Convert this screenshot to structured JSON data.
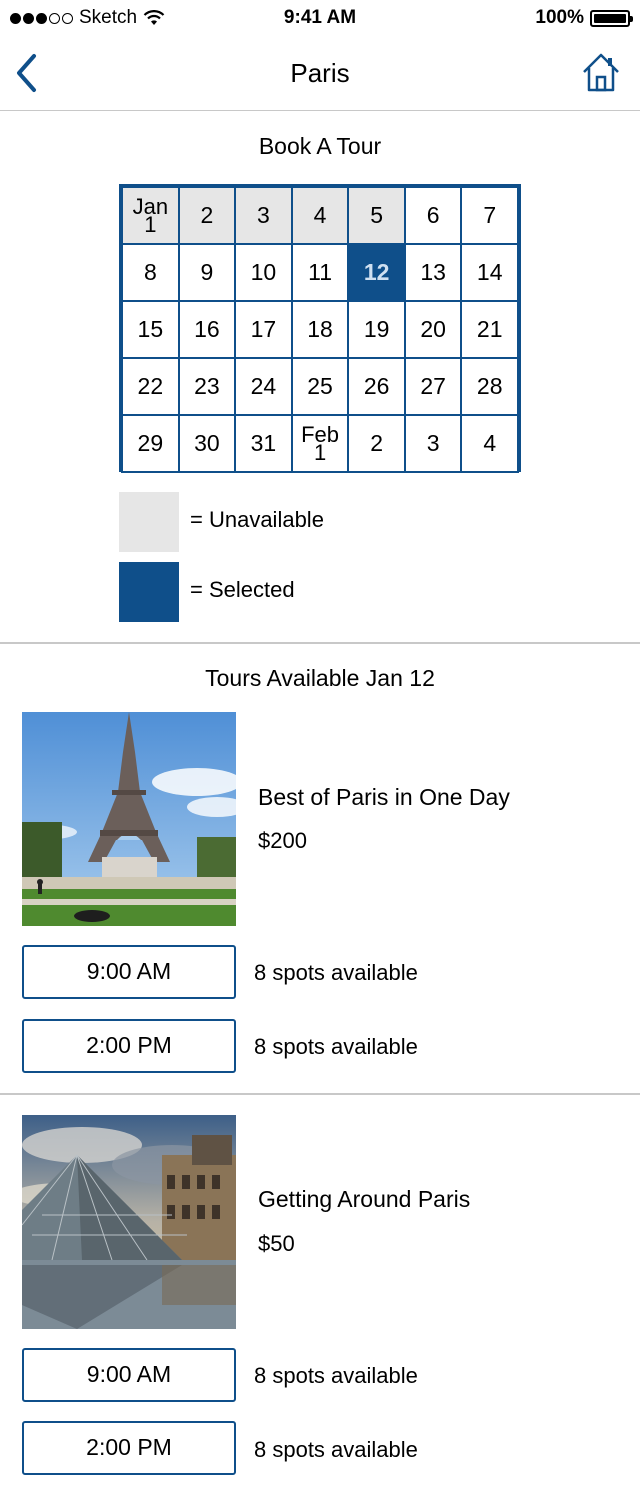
{
  "status_bar": {
    "carrier": "Sketch",
    "time": "9:41 AM",
    "battery": "100%",
    "signal_bars_full": 3,
    "signal_bars_total": 5
  },
  "nav": {
    "title": "Paris",
    "back_icon": "chevron-left-icon",
    "home_icon": "home-icon"
  },
  "calendar": {
    "title": "Book A Tour",
    "weeks": [
      [
        {
          "label": "Jan 1",
          "top": "Jan",
          "bottom": "1",
          "state": "unavailable"
        },
        {
          "label": "2",
          "state": "unavailable"
        },
        {
          "label": "3",
          "state": "unavailable"
        },
        {
          "label": "4",
          "state": "unavailable"
        },
        {
          "label": "5",
          "state": "unavailable"
        },
        {
          "label": "6",
          "state": "available"
        },
        {
          "label": "7",
          "state": "available"
        }
      ],
      [
        {
          "label": "8",
          "state": "available"
        },
        {
          "label": "9",
          "state": "available"
        },
        {
          "label": "10",
          "state": "available"
        },
        {
          "label": "11",
          "state": "available"
        },
        {
          "label": "12",
          "state": "selected"
        },
        {
          "label": "13",
          "state": "available"
        },
        {
          "label": "14",
          "state": "available"
        }
      ],
      [
        {
          "label": "15",
          "state": "available"
        },
        {
          "label": "16",
          "state": "available"
        },
        {
          "label": "17",
          "state": "available"
        },
        {
          "label": "18",
          "state": "available"
        },
        {
          "label": "19",
          "state": "available"
        },
        {
          "label": "20",
          "state": "available"
        },
        {
          "label": "21",
          "state": "available"
        }
      ],
      [
        {
          "label": "22",
          "state": "available"
        },
        {
          "label": "23",
          "state": "available"
        },
        {
          "label": "24",
          "state": "available"
        },
        {
          "label": "25",
          "state": "available"
        },
        {
          "label": "26",
          "state": "available"
        },
        {
          "label": "27",
          "state": "available"
        },
        {
          "label": "28",
          "state": "available"
        }
      ],
      [
        {
          "label": "29",
          "state": "available"
        },
        {
          "label": "30",
          "state": "available"
        },
        {
          "label": "31",
          "state": "available"
        },
        {
          "label": "Feb 1",
          "top": "Feb",
          "bottom": "1",
          "state": "available"
        },
        {
          "label": "2",
          "state": "available"
        },
        {
          "label": "3",
          "state": "available"
        },
        {
          "label": "4",
          "state": "available"
        }
      ]
    ]
  },
  "legend": {
    "unavailable": "= Unavailable",
    "selected": "= Selected"
  },
  "tours_section": {
    "title": "Tours Available Jan 12"
  },
  "tours": [
    {
      "name": "Best of Paris in One Day",
      "price": "$200",
      "image": "eiffel-tower-photo",
      "times": [
        {
          "time": "9:00 AM",
          "spots": "8 spots available"
        },
        {
          "time": "2:00 PM",
          "spots": "8 spots available"
        }
      ]
    },
    {
      "name": "Getting Around Paris",
      "price": "$50",
      "image": "louvre-pyramid-photo",
      "times": [
        {
          "time": "9:00 AM",
          "spots": "8 spots available"
        },
        {
          "time": "2:00 PM",
          "spots": "8 spots available"
        }
      ]
    }
  ],
  "colors": {
    "accent": "#0f4f8a",
    "unavailable": "#e6e6e6",
    "divider": "#c8c8c8"
  }
}
